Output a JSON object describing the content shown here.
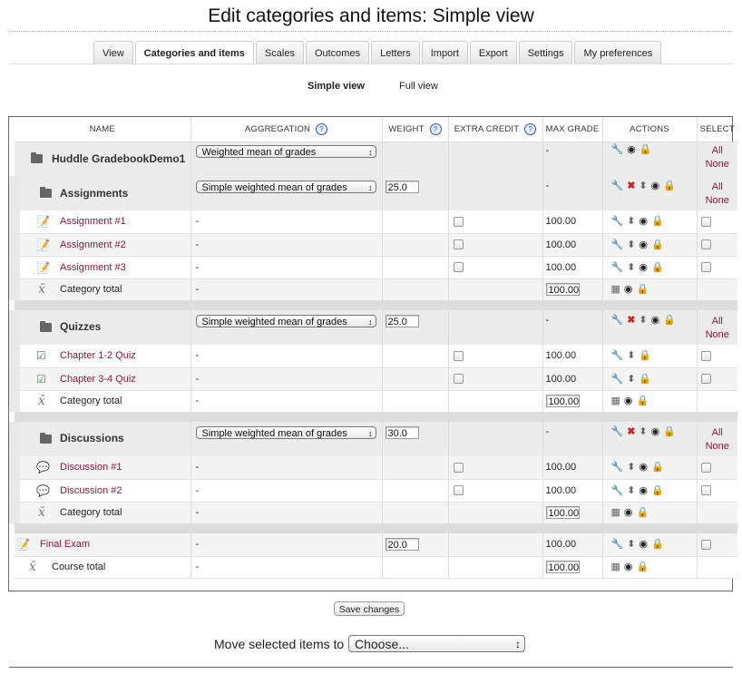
{
  "page": {
    "title": "Edit categories and items: Simple view"
  },
  "tabs": [
    "View",
    "Categories and items",
    "Scales",
    "Outcomes",
    "Letters",
    "Import",
    "Export",
    "Settings",
    "My preferences"
  ],
  "subtabs": {
    "simple": "Simple view",
    "full": "Full view"
  },
  "headers": {
    "name": "NAME",
    "aggregation": "AGGREGATION",
    "weight": "WEIGHT",
    "extra_credit": "EXTRA CREDIT",
    "max_grade": "MAX GRADE",
    "actions": "ACTIONS",
    "select": "SELECT",
    "help": "?"
  },
  "common": {
    "dash": "-",
    "all": "All",
    "none": "None"
  },
  "course": {
    "name": "Huddle GradebookDemo1",
    "aggregation": "Weighted mean of grades",
    "max": "-"
  },
  "cats": [
    {
      "name": "Assignments",
      "aggregation": "Simple weighted mean of grades",
      "weight": "25.0",
      "max": "-",
      "items": [
        {
          "name": "Assignment #1",
          "max": "100.00"
        },
        {
          "name": "Assignment #2",
          "max": "100.00"
        },
        {
          "name": "Assignment #3",
          "max": "100.00"
        }
      ],
      "total": {
        "name": "Category total",
        "max": "100.00"
      }
    },
    {
      "name": "Quizzes",
      "aggregation": "Simple weighted mean of grades",
      "weight": "25.0",
      "max": "-",
      "items": [
        {
          "name": "Chapter 1-2 Quiz",
          "max": "100.00"
        },
        {
          "name": "Chapter 3-4 Quiz",
          "max": "100.00"
        }
      ],
      "total": {
        "name": "Category total",
        "max": "100.00"
      }
    },
    {
      "name": "Discussions",
      "aggregation": "Simple weighted mean of grades",
      "weight": "30.0",
      "max": "-",
      "items": [
        {
          "name": "Discussion #1",
          "max": "100.00"
        },
        {
          "name": "Discussion #2",
          "max": "100.00"
        }
      ],
      "total": {
        "name": "Category total",
        "max": "100.00"
      }
    }
  ],
  "final": {
    "name": "Final Exam",
    "weight": "20.0",
    "max": "100.00"
  },
  "course_total": {
    "name": "Course total",
    "max": "100.00"
  },
  "buttons": {
    "save": "Save changes"
  },
  "move": {
    "label": "Move selected items to",
    "selected": "Choose..."
  },
  "colors": {
    "link": "#8a1a35",
    "delete": "#cc2222"
  }
}
